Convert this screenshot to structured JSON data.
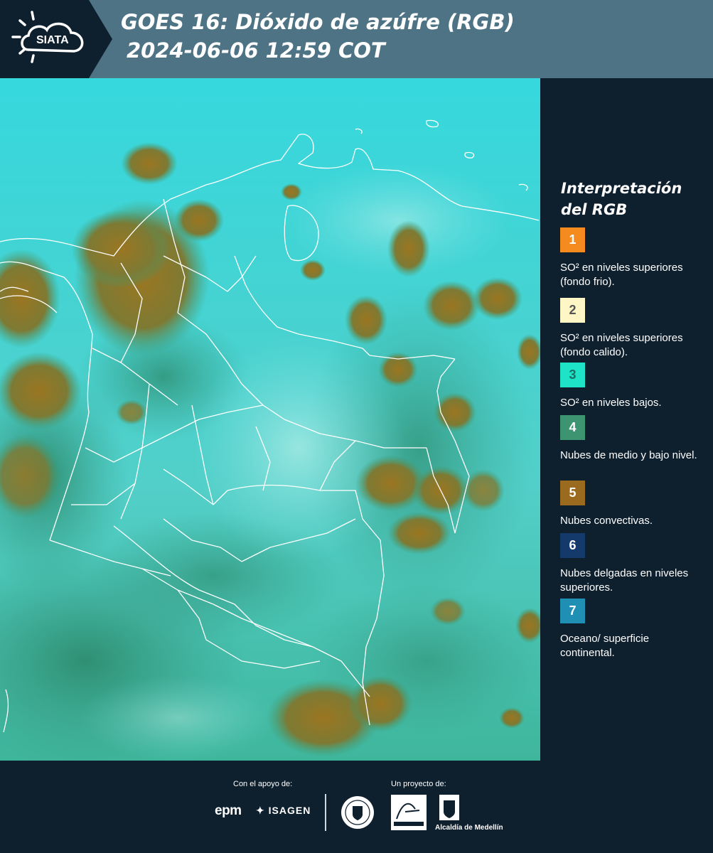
{
  "header": {
    "logo_text": "SIATA",
    "title_line1": "GOES 16: Dióxido de azúfre (RGB)",
    "title_line2": "2024-06-06 12:59 COT",
    "colors": {
      "band": "#4d7384",
      "logo_bg": "#0e1f2e"
    }
  },
  "map": {
    "product": "GOES 16 SO2 RGB",
    "colors": {
      "background": "#3ad6dc",
      "convective": "#9a7a2a",
      "mid_low": "#3f9a72",
      "borders": "#ffffff"
    }
  },
  "legend": {
    "title": "Interpretación del RGB",
    "items": [
      {
        "number": "1",
        "color": "#f58a1e",
        "text_color": "#ffffff",
        "label": "SO² en niveles superiores (fondo frio)."
      },
      {
        "number": "2",
        "color": "#fff6c6",
        "text_color": "#555555",
        "label": "SO² en niveles superiores (fondo calido)."
      },
      {
        "number": "3",
        "color": "#1ee3c7",
        "text_color": "#1a6e66",
        "label": "SO² en niveles bajos."
      },
      {
        "number": "4",
        "color": "#3c9470",
        "text_color": "#ffffff",
        "label": "Nubes de medio y bajo nivel."
      },
      {
        "number": "5",
        "color": "#9a6a1e",
        "text_color": "#ffffff",
        "label": "Nubes convectivas."
      },
      {
        "number": "6",
        "color": "#133a6a",
        "text_color": "#ffffff",
        "label": "Nubes delgadas en niveles superiores."
      },
      {
        "number": "7",
        "color": "#1f8fb4",
        "text_color": "#ffffff",
        "label": "Oceano/ superficie continental."
      }
    ]
  },
  "footer": {
    "support_label": "Con el apoyo de:",
    "project_label": "Un proyecto de:",
    "sponsors": [
      "epm",
      "ISAGEN"
    ],
    "partners": [
      "Área Metropolitana Valle de Aburrá",
      "Alcaldía de Medellín"
    ],
    "alcaldia_label": "Alcaldía de Medellín"
  }
}
